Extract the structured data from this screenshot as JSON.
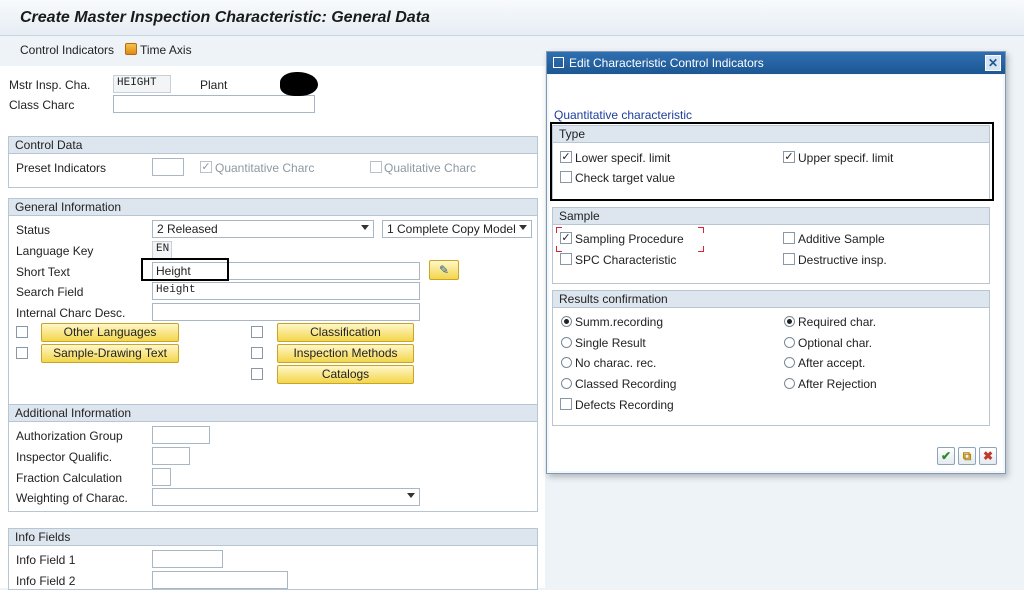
{
  "window": {
    "title": "Create Master Inspection Characteristic: General Data"
  },
  "toolbar": {
    "control_indicators": "Control Indicators",
    "time_axis": "Time Axis"
  },
  "header": {
    "mstr_label": "Mstr Insp. Cha.",
    "mstr_value": "HEIGHT",
    "plant_label": "Plant",
    "class_label": "Class Charc",
    "class_value": ""
  },
  "control_data": {
    "title": "Control Data",
    "preset_label": "Preset Indicators",
    "quant_label": "Quantitative Charc",
    "quant_checked": true,
    "qual_label": "Qualitative Charc",
    "qual_checked": false
  },
  "general": {
    "title": "General Information",
    "status_label": "Status",
    "status_value": "2 Released",
    "copy_value": "1 Complete Copy Model",
    "lang_label": "Language Key",
    "lang_value": "EN",
    "short_label": "Short Text",
    "short_value": "Height",
    "search_label": "Search Field",
    "search_value": "Height",
    "internal_label": "Internal Charc Desc.",
    "internal_value": "",
    "btn_other_languages": "Other Languages",
    "btn_sample_drawing": "Sample-Drawing Text",
    "btn_classification": "Classification",
    "btn_inspection_methods": "Inspection Methods",
    "btn_catalogs": "Catalogs"
  },
  "additional": {
    "title": "Additional Information",
    "auth_label": "Authorization Group",
    "inspector_label": "Inspector Qualific.",
    "fraction_label": "Fraction Calculation",
    "weighting_label": "Weighting of Charac."
  },
  "info_fields": {
    "title": "Info Fields",
    "f1_label": "Info Field 1",
    "f2_label": "Info Field 2"
  },
  "dialog": {
    "title": "Edit Characteristic Control Indicators",
    "close": "✕",
    "subtitle": "Quantitative characteristic",
    "type": {
      "title": "Type",
      "lower": "Lower specif. limit",
      "lower_checked": true,
      "upper": "Upper specif. limit",
      "upper_checked": true,
      "target": "Check target value",
      "target_checked": false
    },
    "sample": {
      "title": "Sample",
      "sampling": "Sampling Procedure",
      "sampling_checked": true,
      "additive": "Additive Sample",
      "additive_checked": false,
      "spc": "SPC Characteristic",
      "spc_checked": false,
      "destructive": "Destructive insp.",
      "destructive_checked": false
    },
    "results": {
      "title": "Results confirmation",
      "summ": "Summ.recording",
      "single": "Single Result",
      "no_charac": "No charac. rec.",
      "classed": "Classed Recording",
      "defects": "Defects Recording",
      "required": "Required char.",
      "optional": "Optional char.",
      "after_accept": "After accept.",
      "after_reject": "After Rejection",
      "selected_left": "Summ.recording",
      "selected_right": "Required char."
    },
    "footer": {
      "ok": "✔",
      "copy": "⧉",
      "cancel": "✖"
    }
  },
  "colors": {
    "accent": "#1d5794",
    "button_yellow": "#f3d64a",
    "panel_header": "#dde6ef"
  }
}
